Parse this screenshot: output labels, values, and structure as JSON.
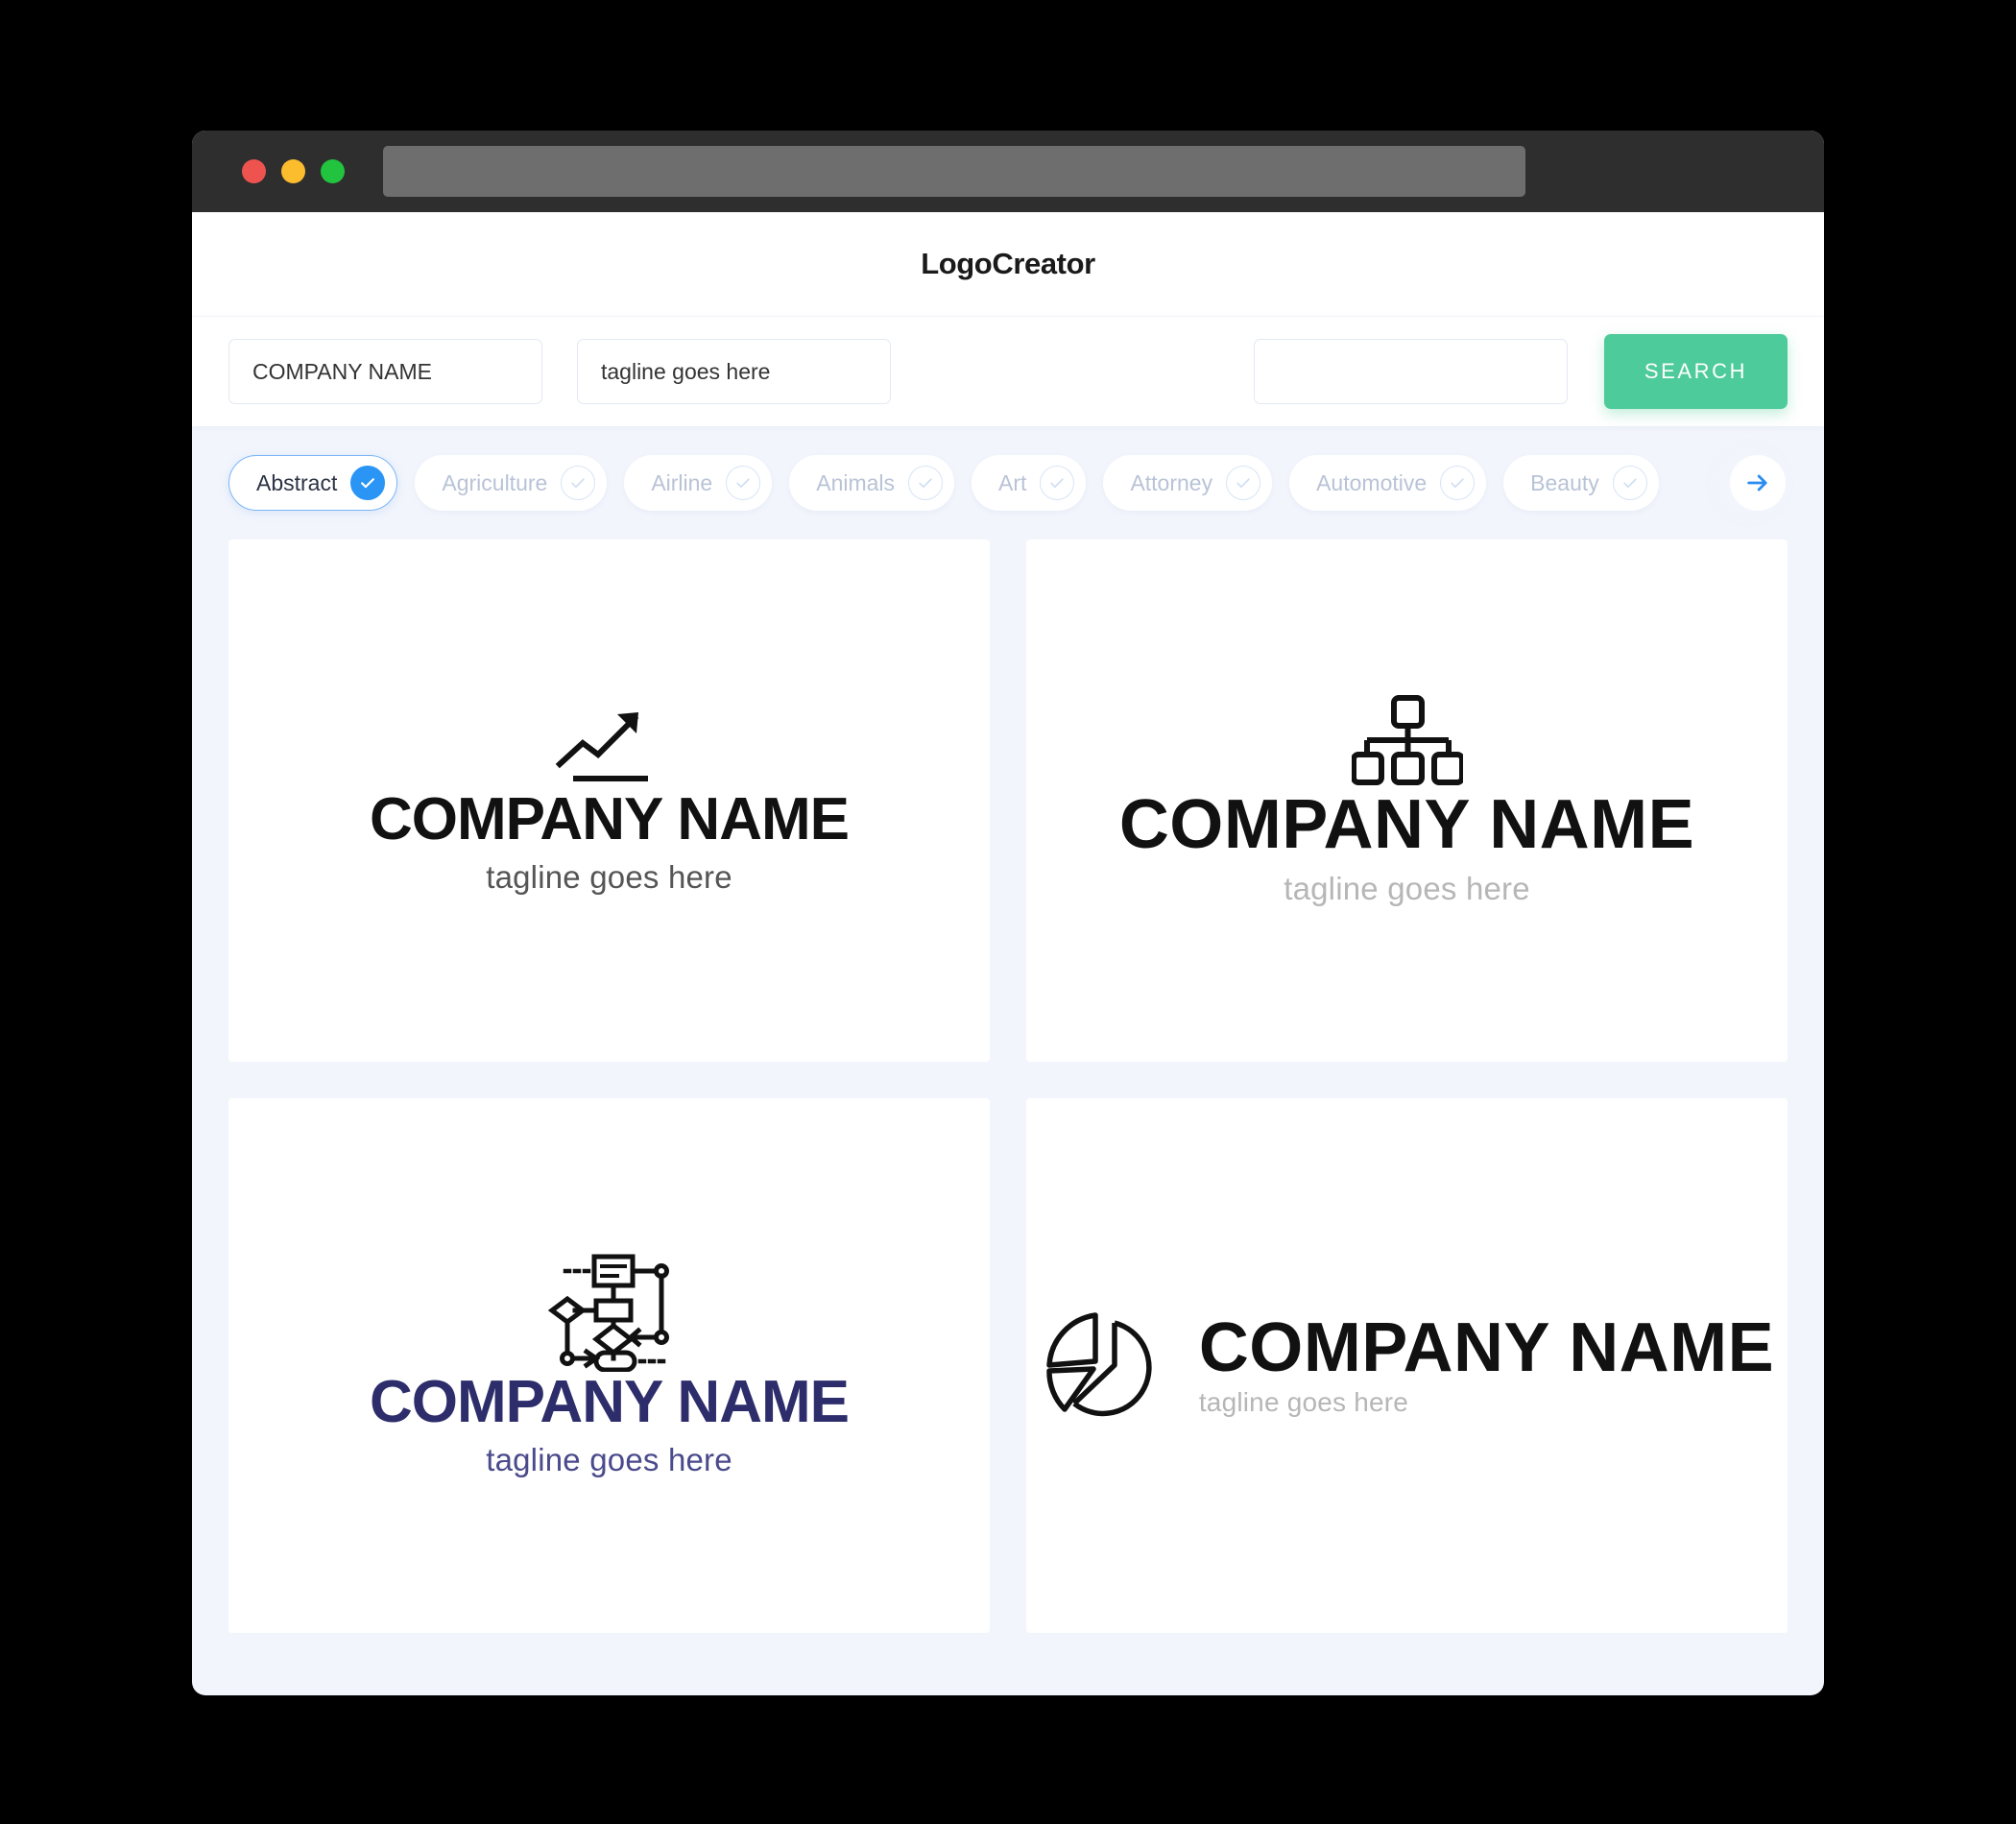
{
  "window": {
    "traffic_lights": [
      "close",
      "minimize",
      "maximize"
    ],
    "url_value": ""
  },
  "header": {
    "title": "LogoCreator"
  },
  "search": {
    "company_value": "COMPANY NAME",
    "tagline_value": "tagline goes here",
    "third_value": "",
    "button_label": "SEARCH",
    "button_color": "#4ecb9a"
  },
  "filters": {
    "accent_color": "#2a95f5",
    "next_icon": "arrow-right-icon",
    "items": [
      {
        "label": "Abstract",
        "selected": true
      },
      {
        "label": "Agriculture",
        "selected": false
      },
      {
        "label": "Airline",
        "selected": false
      },
      {
        "label": "Animals",
        "selected": false
      },
      {
        "label": "Art",
        "selected": false
      },
      {
        "label": "Attorney",
        "selected": false
      },
      {
        "label": "Automotive",
        "selected": false
      },
      {
        "label": "Beauty",
        "selected": false
      }
    ]
  },
  "logos": [
    {
      "icon": "growth-arrow-icon",
      "name": "COMPANY NAME",
      "tagline": "tagline goes here",
      "layout": "stacked",
      "name_color": "#111111",
      "tagline_color": "#555555"
    },
    {
      "icon": "org-chart-icon",
      "name": "COMPANY NAME",
      "tagline": "tagline goes here",
      "layout": "stacked",
      "name_color": "#111111",
      "tagline_color": "#b6b6b6"
    },
    {
      "icon": "flowchart-icon",
      "name": "COMPANY NAME",
      "tagline": "tagline goes here",
      "layout": "stacked",
      "name_color": "#2d2d6b",
      "tagline_color": "#4a4a8c"
    },
    {
      "icon": "pie-chart-icon",
      "name": "COMPANY NAME",
      "tagline": "tagline goes here",
      "layout": "horizontal",
      "name_color": "#111111",
      "tagline_color": "#b6b6b6"
    }
  ]
}
